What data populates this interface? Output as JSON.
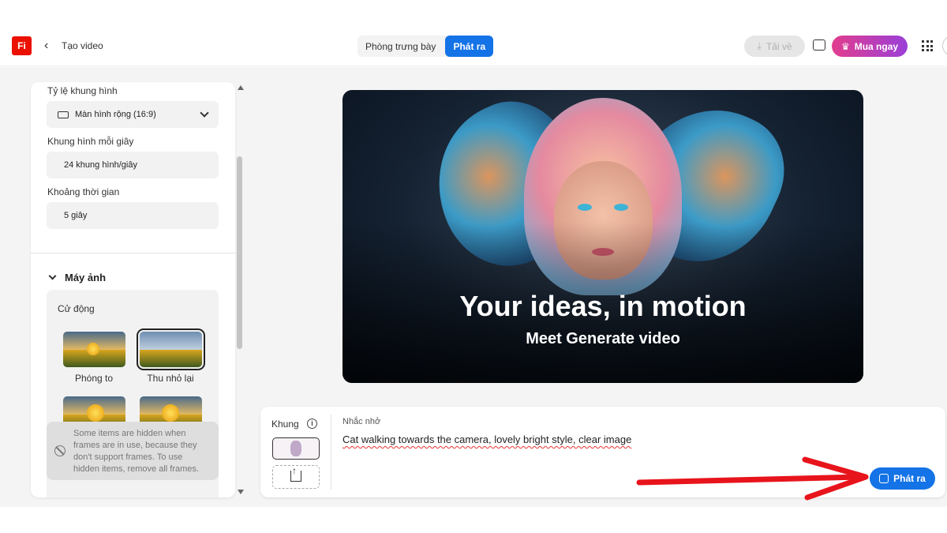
{
  "header": {
    "logo": "Fi",
    "back_label": "Tạo video",
    "tabs": [
      {
        "label": "Phòng trưng bày"
      },
      {
        "label": "Phát ra"
      }
    ],
    "download_label": "Tải về",
    "buy_label": "Mua ngay"
  },
  "settings": {
    "aspect_label": "Tỷ lệ khung hình",
    "aspect_value": "Màn hình rộng (16:9)",
    "fps_label": "Khung hình mỗi giây",
    "fps_value": "24 khung hình/giây",
    "duration_label": "Khoảng thời gian",
    "duration_value": "5 giây"
  },
  "camera": {
    "section_title": "Máy ảnh",
    "motion_label": "Cử động",
    "motions": [
      {
        "label": "Phóng to"
      },
      {
        "label": "Thu nhỏ lại"
      }
    ],
    "hidden_note": "Some items are hidden when frames are in use, because they don't support frames. To use hidden items, remove all frames."
  },
  "preview": {
    "title": "Your ideas, in motion",
    "subtitle": "Meet Generate video"
  },
  "prompt": {
    "frame_label": "Khung",
    "prompt_label": "Nhắc nhở",
    "prompt_text": "Cat walking towards the camera, lovely bright style, clear image",
    "generate_label": "Phát ra"
  },
  "colors": {
    "accent": "#1473e6",
    "brand": "#eb1000",
    "annotation_arrow": "#e8141c"
  }
}
